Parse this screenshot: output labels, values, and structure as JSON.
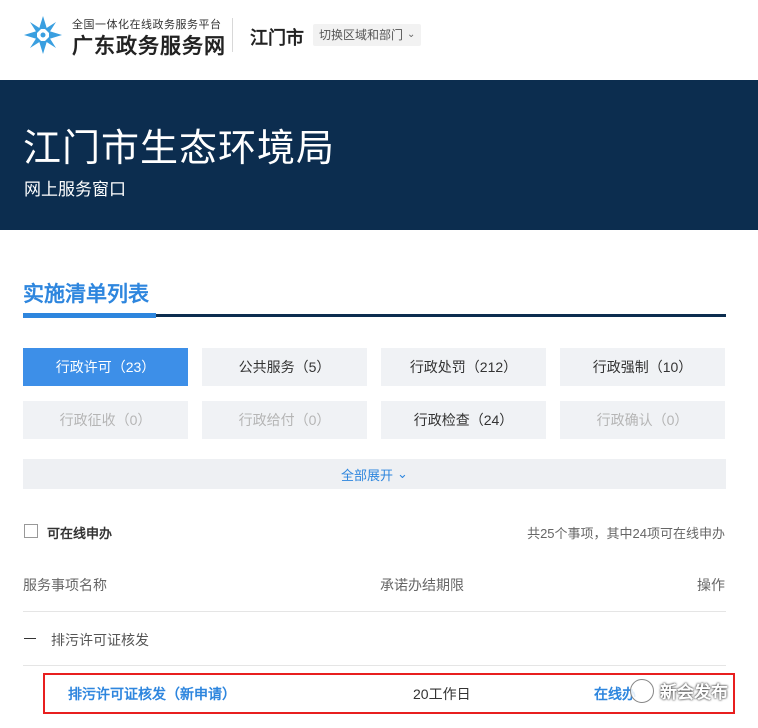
{
  "header": {
    "logo_small": "全国一体化在线政务服务平台",
    "logo_big": "广东政务服务网",
    "city": "江门市",
    "switch_label": "切换区域和部门"
  },
  "banner": {
    "title": "江门市生态环境局",
    "subtitle": "网上服务窗口"
  },
  "section": {
    "title": "实施清单列表"
  },
  "filters": [
    {
      "label": "行政许可（23）",
      "state": "active"
    },
    {
      "label": "公共服务（5）",
      "state": "normal"
    },
    {
      "label": "行政处罚（212）",
      "state": "normal"
    },
    {
      "label": "行政强制（10）",
      "state": "normal"
    },
    {
      "label": "行政征收（0）",
      "state": "disabled"
    },
    {
      "label": "行政给付（0）",
      "state": "disabled"
    },
    {
      "label": "行政检查（24）",
      "state": "normal"
    },
    {
      "label": "行政确认（0）",
      "state": "disabled"
    }
  ],
  "expand_label": "全部展开",
  "online": {
    "label": "可在线申办",
    "summary": "共25个事项，其中24项可在线申办"
  },
  "table": {
    "col_name": "服务事项名称",
    "col_days": "承诺办结期限",
    "col_action": "操作",
    "group": "排污许可证核发",
    "item_name": "排污许可证核发（新申请）",
    "item_days": "20工作日",
    "item_action": "在线办"
  },
  "watermark": "新会发布",
  "colors": {
    "brand_blue": "#2e86de",
    "banner_navy": "#0c2d4f",
    "highlight_red": "#e81f1f"
  }
}
